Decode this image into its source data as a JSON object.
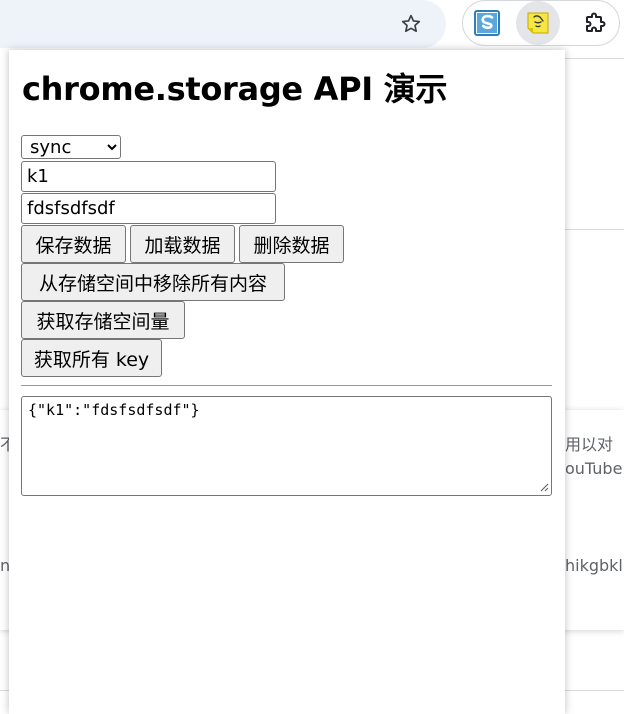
{
  "toolbar": {
    "bookmark_icon": "star-icon",
    "extensions": [
      {
        "name": "s-extension",
        "icon": "s-logo-icon"
      },
      {
        "name": "storage-demo-extension",
        "icon": "extension-sticker-icon",
        "active": true
      },
      {
        "name": "extensions-menu",
        "icon": "puzzle-icon"
      }
    ]
  },
  "background_page": {
    "text_fragments": [
      "不",
      "用以对",
      "ouTube",
      "n",
      "hikgbkl"
    ]
  },
  "popup": {
    "title": "chrome.storage API 演示",
    "storage_area": {
      "selected": "sync",
      "options": [
        "sync"
      ]
    },
    "key_input": {
      "value": "k1"
    },
    "value_input": {
      "value": "fdsfsdfsdf"
    },
    "buttons": {
      "save": "保存数据",
      "load": "加载数据",
      "remove": "删除数据",
      "clear": "从存储空间中移除所有内容",
      "bytes_in_use": "获取存储空间量",
      "get_all_keys": "获取所有 key"
    },
    "output": "{\"k1\":\"fdsfsdfsdf\"}"
  }
}
